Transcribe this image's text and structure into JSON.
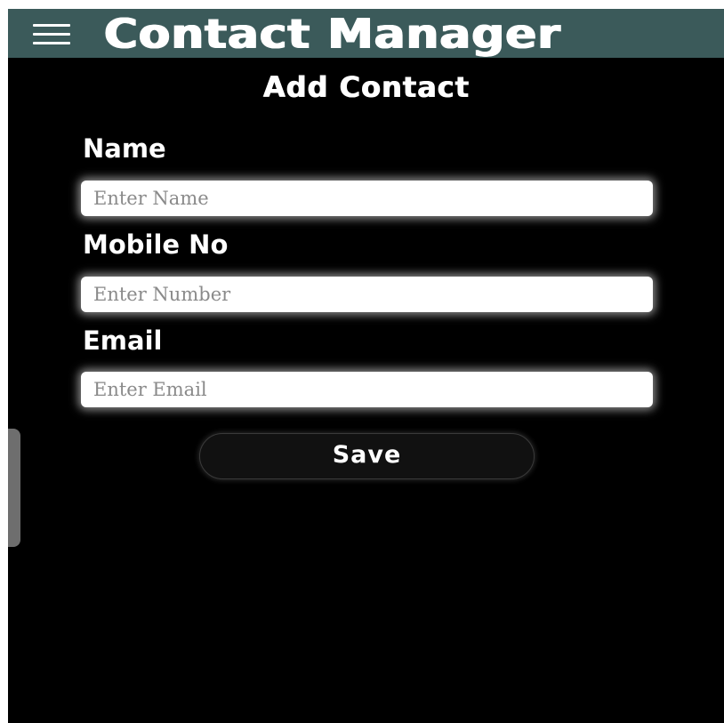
{
  "app": {
    "title": "Contact Manager",
    "menu_icon": "hamburger-menu-icon"
  },
  "form": {
    "title": "Add Contact",
    "fields": [
      {
        "label": "Name",
        "placeholder": "Enter Name",
        "value": ""
      },
      {
        "label": "Mobile No",
        "placeholder": "Enter Number",
        "value": ""
      },
      {
        "label": "Email",
        "placeholder": "Enter Email",
        "value": ""
      }
    ],
    "save_label": "Save"
  },
  "colors": {
    "appbar_bg": "#3b5a5a",
    "screen_bg": "#000000",
    "text": "#ffffff",
    "button_bg": "#111111"
  }
}
